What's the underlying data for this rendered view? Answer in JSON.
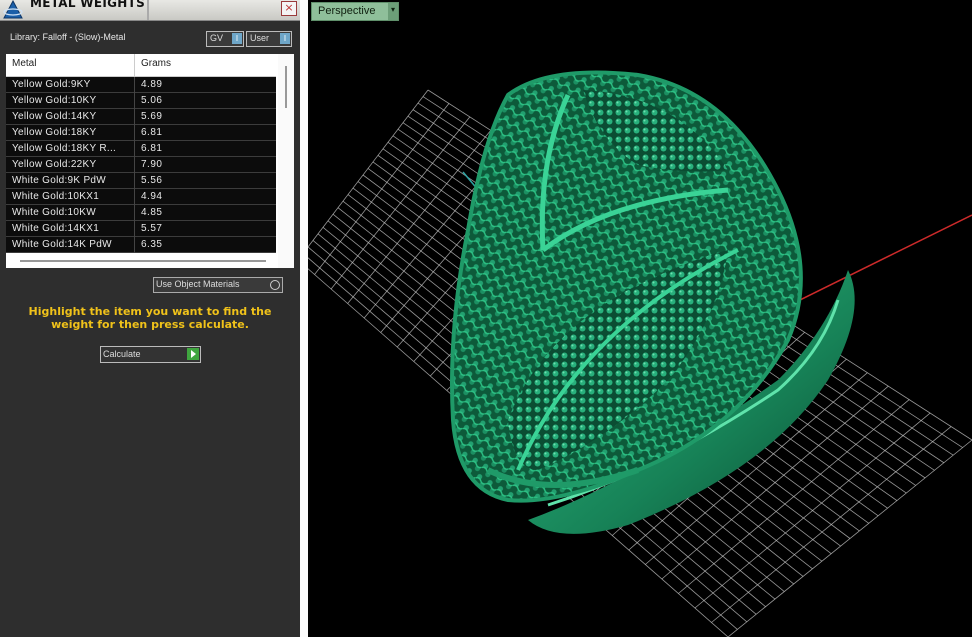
{
  "panel": {
    "title": "METAL WEIGHTS",
    "close": "×",
    "library": "Library: Falloff - (Slow)-Metal",
    "toggles": [
      {
        "label": "GV",
        "btn": "I"
      },
      {
        "label": "User",
        "btn": "I"
      }
    ],
    "table": {
      "headers": {
        "metal": "Metal",
        "grams": "Grams"
      },
      "rows": [
        {
          "metal": "Yellow Gold:9KY",
          "grams": "4.89"
        },
        {
          "metal": "Yellow Gold:10KY",
          "grams": "5.06"
        },
        {
          "metal": "Yellow Gold:14KY",
          "grams": "5.69"
        },
        {
          "metal": "Yellow Gold:18KY",
          "grams": "6.81"
        },
        {
          "metal": "Yellow Gold:18KY R...",
          "grams": "6.81"
        },
        {
          "metal": "Yellow Gold:22KY",
          "grams": "7.90"
        },
        {
          "metal": "White Gold:9K PdW",
          "grams": "5.56"
        },
        {
          "metal": "White Gold:10KX1",
          "grams": "4.94"
        },
        {
          "metal": "White Gold:10KW",
          "grams": "4.85"
        },
        {
          "metal": "White Gold:14KX1",
          "grams": "5.57"
        },
        {
          "metal": "White Gold:14K PdW",
          "grams": "6.35"
        }
      ]
    },
    "use_object_materials": "Use Object Materials",
    "instructions": "Highlight the item you want to find the weight for then press calculate.",
    "calculate": "Calculate"
  },
  "viewport": {
    "view_name": "Perspective",
    "dropdown": "▾",
    "model_color": "#1a8a5a",
    "grid_color": "#c8c8c8",
    "axis_x_color": "#cc2a2a",
    "axis_y_color": "#2fa3a3"
  }
}
